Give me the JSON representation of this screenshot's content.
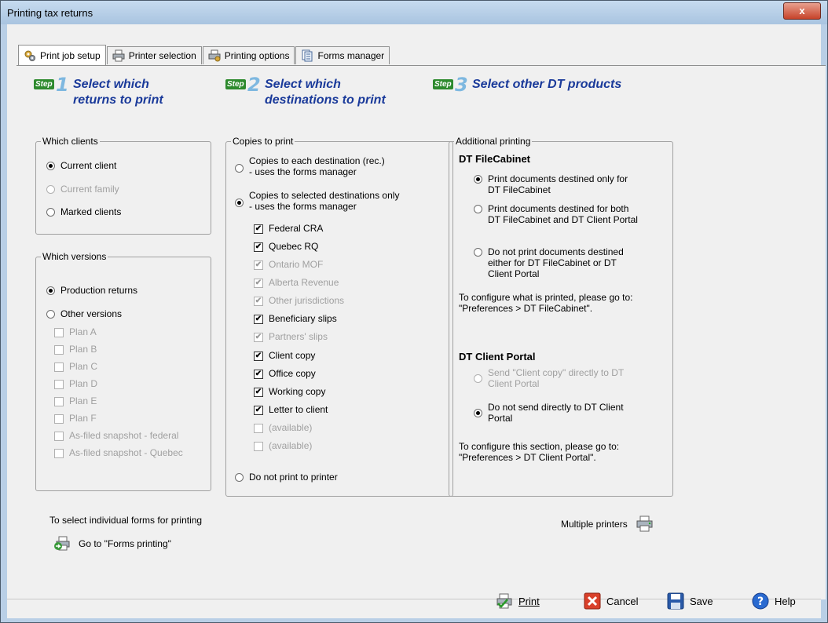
{
  "window": {
    "title": "Printing tax returns",
    "close_label": "x"
  },
  "tabs": [
    {
      "label": "Print job setup",
      "active": true,
      "icon": "gears-icon"
    },
    {
      "label": "Printer selection",
      "active": false,
      "icon": "printer-icon"
    },
    {
      "label": "Printing options",
      "active": false,
      "icon": "printer-options-icon"
    },
    {
      "label": "Forms manager",
      "active": false,
      "icon": "forms-icon"
    }
  ],
  "steps": [
    {
      "badge": "Step",
      "num": "1",
      "text_line1": "Select which",
      "text_line2": "returns to print"
    },
    {
      "badge": "Step",
      "num": "2",
      "text_line1": "Select which",
      "text_line2": "destinations to print"
    },
    {
      "badge": "Step",
      "num": "3",
      "text_line1": "Select other DT products",
      "text_line2": ""
    }
  ],
  "which_clients": {
    "legend": "Which clients",
    "options": [
      {
        "label": "Current client",
        "selected": true,
        "disabled": false
      },
      {
        "label": "Current family",
        "selected": false,
        "disabled": true
      },
      {
        "label": "Marked clients",
        "selected": false,
        "disabled": false
      }
    ]
  },
  "which_versions": {
    "legend": "Which versions",
    "options": [
      {
        "label": "Production returns",
        "selected": true,
        "disabled": false
      },
      {
        "label": "Other versions",
        "selected": false,
        "disabled": false
      }
    ],
    "plans": [
      {
        "label": "Plan A"
      },
      {
        "label": "Plan B"
      },
      {
        "label": "Plan C"
      },
      {
        "label": "Plan D"
      },
      {
        "label": "Plan E"
      },
      {
        "label": "Plan F"
      },
      {
        "label": "As-filed snapshot - federal"
      },
      {
        "label": "As-filed snapshot - Quebec"
      }
    ]
  },
  "copies": {
    "legend": "Copies to print",
    "opt1_line1": "Copies to each destination (rec.)",
    "opt1_line2": "- uses the forms manager",
    "opt2_line1": "Copies to selected destinations only",
    "opt2_line2": "- uses the forms manager",
    "destinations": [
      {
        "label": "Federal CRA",
        "checked": true,
        "disabled": false
      },
      {
        "label": "Quebec RQ",
        "checked": true,
        "disabled": false
      },
      {
        "label": "Ontario MOF",
        "checked": true,
        "disabled": true
      },
      {
        "label": "Alberta Revenue",
        "checked": true,
        "disabled": true
      },
      {
        "label": "Other jurisdictions",
        "checked": true,
        "disabled": true
      },
      {
        "label": "Beneficiary slips",
        "checked": true,
        "disabled": false
      },
      {
        "label": "Partners' slips",
        "checked": true,
        "disabled": true
      },
      {
        "label": "Client copy",
        "checked": true,
        "disabled": false
      },
      {
        "label": "Office copy",
        "checked": true,
        "disabled": false
      },
      {
        "label": "Working copy",
        "checked": true,
        "disabled": false
      },
      {
        "label": "Letter to client",
        "checked": true,
        "disabled": false
      },
      {
        "label": "(available)",
        "checked": false,
        "disabled": true
      },
      {
        "label": "(available)",
        "checked": false,
        "disabled": true
      }
    ],
    "opt3": "Do not print to printer"
  },
  "additional": {
    "legend": "Additional printing",
    "filecabinet_heading": "DT FileCabinet",
    "fc_opt1_l1": "Print documents destined only for",
    "fc_opt1_l2": "DT FileCabinet",
    "fc_opt2_l1": "Print documents destined for both",
    "fc_opt2_l2": "DT FileCabinet and DT Client Portal",
    "fc_opt3_l1": "Do not print documents destined",
    "fc_opt3_l2": "either for DT FileCabinet or DT",
    "fc_opt3_l3": "Client Portal",
    "fc_note_l1": "To configure what is printed, please go to:",
    "fc_note_l2": "\"Preferences > DT FileCabinet\".",
    "portal_heading": "DT Client Portal",
    "cp_opt1_l1": "Send \"Client copy\" directly to DT",
    "cp_opt1_l2": "Client Portal",
    "cp_opt2_l1": "Do not send directly to DT Client",
    "cp_opt2_l2": "Portal",
    "cp_note_l1": "To configure this section, please go to:",
    "cp_note_l2": "\"Preferences > DT Client Portal\"."
  },
  "forms_printing": {
    "caption": "To select individual forms for printing",
    "link": "Go to \"Forms printing\""
  },
  "multiple_printers": "Multiple printers",
  "footer": {
    "print_label": "Print",
    "cancel_label": "Cancel",
    "save_label": "Save",
    "help_label": "Help"
  }
}
